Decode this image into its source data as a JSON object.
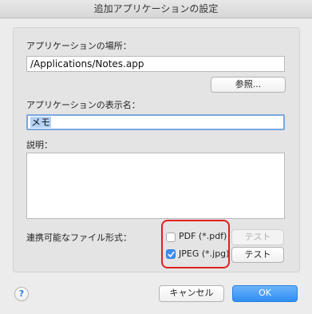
{
  "window": {
    "title": "追加アプリケーションの設定"
  },
  "app_location": {
    "label": "アプリケーションの場所：",
    "value": "/Applications/Notes.app",
    "browse_label": "参照..."
  },
  "display_name": {
    "label": "アプリケーションの表示名：",
    "value": "メモ"
  },
  "description": {
    "label": "説明：",
    "value": ""
  },
  "file_formats": {
    "label": "連携可能なファイル形式：",
    "options": [
      {
        "label": "PDF (*.pdf)",
        "checked": false,
        "test_label": "テスト",
        "test_enabled": false
      },
      {
        "label": "JPEG (*.jpg)",
        "checked": true,
        "test_label": "テスト",
        "test_enabled": true
      }
    ]
  },
  "footer": {
    "help_label": "?",
    "cancel_label": "キャンセル",
    "ok_label": "OK"
  },
  "colors": {
    "accent": "#2f8ef4",
    "highlight": "#e02020"
  }
}
